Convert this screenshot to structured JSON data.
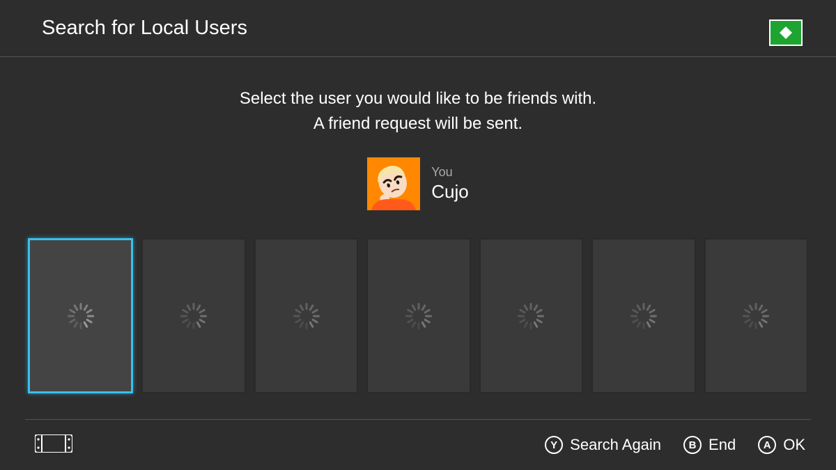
{
  "header": {
    "title": "Search for Local Users"
  },
  "instructions": {
    "line1": "Select the user you would like to be friends with.",
    "line2": "A friend request will be sent."
  },
  "currentUser": {
    "youLabel": "You",
    "name": "Cujo",
    "avatarBg": "#ff8800"
  },
  "slots": {
    "count": 7,
    "selectedIndex": 0,
    "state": "loading"
  },
  "footer": {
    "actions": {
      "y": {
        "glyph": "Y",
        "label": "Search Again"
      },
      "b": {
        "glyph": "B",
        "label": "End"
      },
      "a": {
        "glyph": "A",
        "label": "OK"
      }
    }
  }
}
